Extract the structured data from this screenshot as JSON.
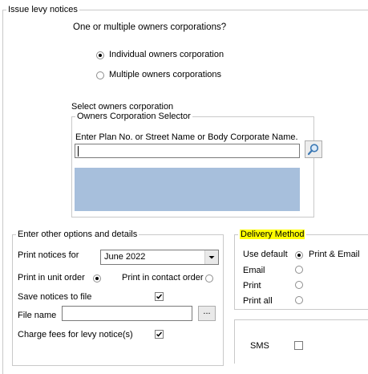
{
  "issue_group": {
    "legend": "Issue levy notices",
    "question": "One or multiple owners corporations?",
    "option_individual": "Individual owners corporation",
    "option_multiple": "Multiple owners corporations",
    "selected": "individual"
  },
  "selector": {
    "heading": "Select owners corporation",
    "legend": "Owners Corporation Selector",
    "prompt": "Enter Plan No. or Street Name or Body Corporate Name.",
    "search_value": "",
    "search_icon": "magnifier-icon",
    "results_color": "#a7bfdc"
  },
  "options": {
    "legend": "Enter other options and details",
    "print_notices_for_label": "Print notices for",
    "print_notices_for_value": "June 2022",
    "unit_order_label": "Print in unit order",
    "contact_order_label": "Print in contact order",
    "order_selected": "unit",
    "save_label": "Save notices to file",
    "save_checked": true,
    "file_name_label": "File name",
    "file_name_value": "",
    "browse_label": "...",
    "charge_fees_label": "Charge fees for levy notice(s)",
    "charge_fees_checked": true
  },
  "delivery": {
    "legend": "Delivery Method",
    "legend_highlight": "#ffff00",
    "use_default_label": "Use default",
    "print_email_label": "Print & Email",
    "email_label": "Email",
    "print_label": "Print",
    "print_all_label": "Print all",
    "selected": "use_default"
  },
  "sms": {
    "label": "SMS",
    "checked": false
  }
}
